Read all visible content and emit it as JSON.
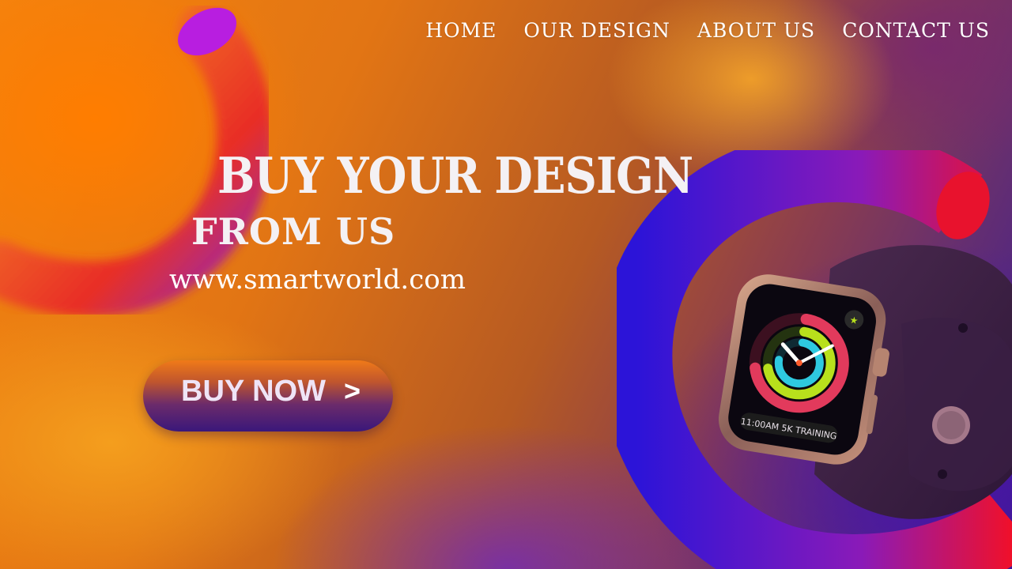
{
  "nav": {
    "items": [
      {
        "label": "HOME"
      },
      {
        "label": "OUR DESIGN"
      },
      {
        "label": "ABOUT US"
      },
      {
        "label": "CONTACT US"
      }
    ]
  },
  "hero": {
    "headline_line1": "BUY YOUR DESIGN",
    "headline_line2": "FROM US",
    "url": "www.smartworld.com",
    "cta_label": "BUY NOW",
    "cta_chevron": ">"
  },
  "watch": {
    "screen_text": "11:00AM 5K TRAINING",
    "icon": "running-figure-icon"
  },
  "colors": {
    "orange": "#f3830f",
    "purple": "#3a1a8a",
    "ring_red": "#e8122d",
    "ring_blue": "#2a1ad0",
    "text": "#ffffff"
  }
}
